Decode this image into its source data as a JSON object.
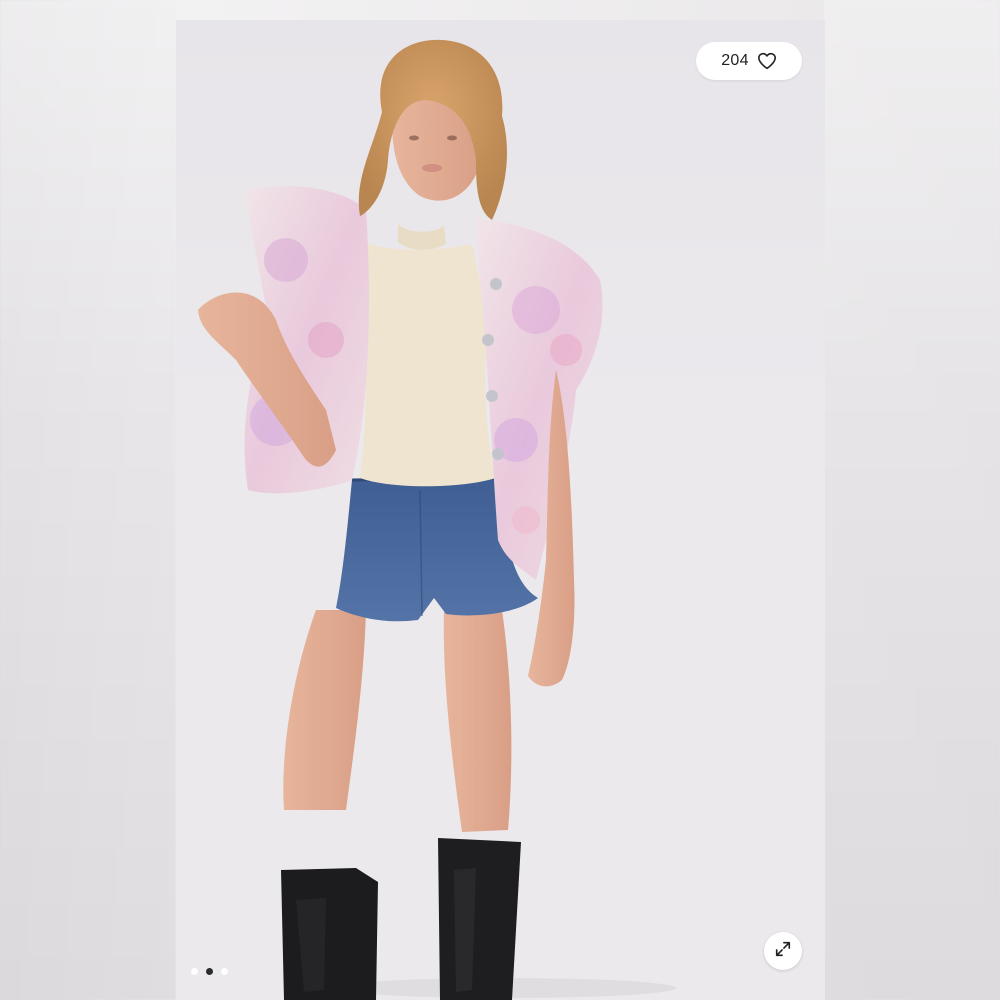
{
  "viewer": {
    "likes": {
      "count": "204",
      "icon": "heart-outline-icon"
    },
    "expand": {
      "icon": "expand-arrows-icon"
    },
    "pagination": {
      "total": 3,
      "active_index": 1
    },
    "photo": {
      "subject": "model-wearing-floral-denim-vest"
    }
  },
  "colors": {
    "pill_bg": "#ffffff",
    "text": "#222222",
    "dot_active": "#222222",
    "dot_inactive": "#ffffff",
    "backdrop": "#eae8eb"
  }
}
